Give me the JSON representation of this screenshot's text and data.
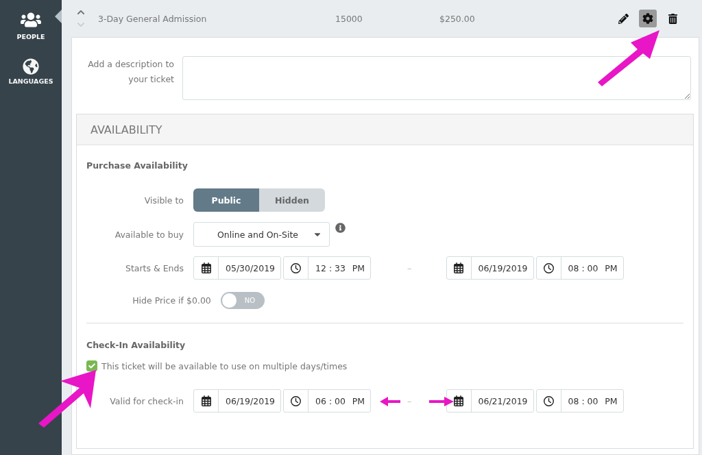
{
  "sidebar": {
    "items": [
      {
        "label": "PEOPLE",
        "selected": true
      },
      {
        "label": "LANGUAGES",
        "selected": false
      }
    ]
  },
  "ticket": {
    "name": "3-Day General Admission",
    "quantity": "15000",
    "price": "$250.00",
    "move_down_disabled": true,
    "actions": [
      {
        "kind": "edit",
        "selected": false
      },
      {
        "kind": "settings",
        "selected": true
      },
      {
        "kind": "delete",
        "selected": false
      }
    ]
  },
  "description": {
    "label": "Add a description to your ticket"
  },
  "availability": {
    "title": "AVAILABILITY",
    "purchase": {
      "heading": "Purchase Availability",
      "visible_to": {
        "label": "Visible to",
        "options": [
          {
            "label": "Public",
            "selected": true
          },
          {
            "label": "Hidden",
            "selected": false
          }
        ]
      },
      "available_to_buy": {
        "label": "Available to buy",
        "value": "Online and On-Site"
      },
      "starts_ends": {
        "label": "Starts & Ends",
        "start": {
          "date": "05/30/2019",
          "time": "12 : 33",
          "period": "PM"
        },
        "separator": "–",
        "end": {
          "date": "06/19/2019",
          "time": "08 : 00",
          "period": "PM"
        }
      },
      "hide_price": {
        "label": "Hide Price if",
        "amount": "$0.00",
        "on": false,
        "state_text": "NO"
      }
    },
    "checkin": {
      "heading": "Check-In Availability",
      "multiple": {
        "label": "This ticket will be available to use on multiple days/times",
        "checked": true
      },
      "valid": {
        "label": "Valid for check-in",
        "start": {
          "date": "06/19/2019",
          "time": "06 : 00",
          "period": "PM"
        },
        "separator": "–",
        "end": {
          "date": "06/21/2019",
          "time": "08 : 00",
          "period": "PM"
        }
      }
    }
  }
}
